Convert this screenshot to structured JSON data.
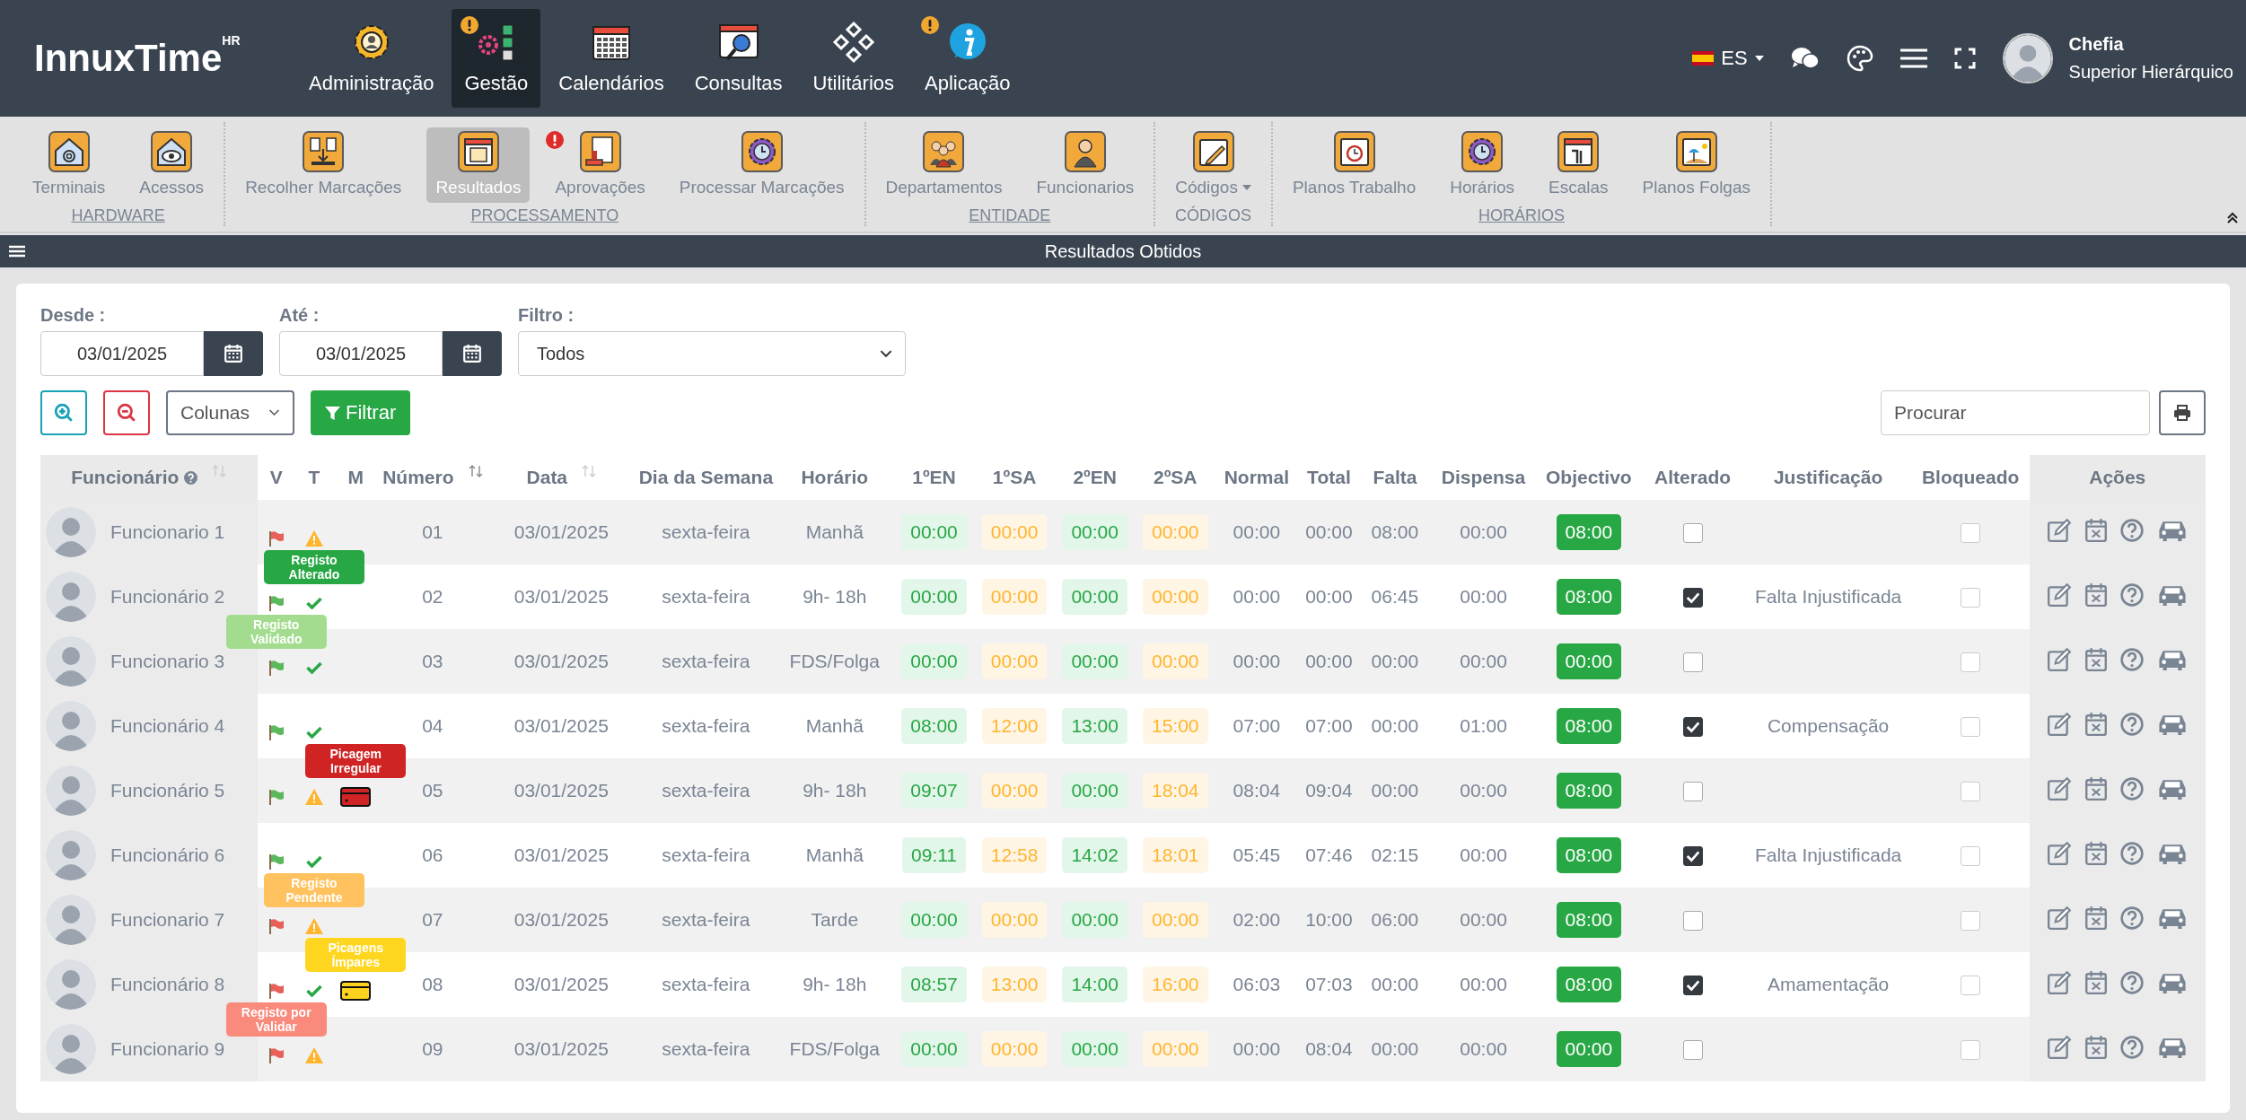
{
  "header": {
    "logo": "InnuxTime",
    "logo_sup": "HR",
    "nav": [
      {
        "label": "Administração",
        "selected": false,
        "alert": false
      },
      {
        "label": "Gestão",
        "selected": true,
        "alert": true
      },
      {
        "label": "Calendários",
        "selected": false,
        "alert": false
      },
      {
        "label": "Consultas",
        "selected": false,
        "alert": false
      },
      {
        "label": "Utilitários",
        "selected": false,
        "alert": false
      },
      {
        "label": "Aplicação",
        "selected": false,
        "alert": true
      }
    ],
    "language": "ES",
    "user": {
      "name": "Chefia",
      "role": "Superior Hierárquico"
    }
  },
  "toolbar": {
    "groups": [
      {
        "label": "HARDWARE",
        "link": true,
        "items": [
          {
            "label": "Terminais",
            "selected": false,
            "alert": false,
            "dropdown": false
          },
          {
            "label": "Acessos",
            "selected": false,
            "alert": false,
            "dropdown": false
          }
        ]
      },
      {
        "label": "PROCESSAMENTO",
        "link": true,
        "items": [
          {
            "label": "Recolher Marcações",
            "selected": false,
            "alert": false,
            "dropdown": false
          },
          {
            "label": "Resultados",
            "selected": true,
            "alert": false,
            "dropdown": false
          },
          {
            "label": "Aprovações",
            "selected": false,
            "alert": true,
            "dropdown": false
          },
          {
            "label": "Processar Marcações",
            "selected": false,
            "alert": false,
            "dropdown": false
          }
        ]
      },
      {
        "label": "ENTIDADE",
        "link": true,
        "items": [
          {
            "label": "Departamentos",
            "selected": false,
            "alert": false,
            "dropdown": false
          },
          {
            "label": "Funcionarios",
            "selected": false,
            "alert": false,
            "dropdown": false
          }
        ]
      },
      {
        "label": "CÓDIGOS",
        "link": false,
        "items": [
          {
            "label": "Códigos",
            "selected": false,
            "alert": false,
            "dropdown": true
          }
        ]
      },
      {
        "label": "HORÁRIOS",
        "link": true,
        "items": [
          {
            "label": "Planos Trabalho",
            "selected": false,
            "alert": false,
            "dropdown": false
          },
          {
            "label": "Horários",
            "selected": false,
            "alert": false,
            "dropdown": false
          },
          {
            "label": "Escalas",
            "selected": false,
            "alert": false,
            "dropdown": false
          },
          {
            "label": "Planos Folgas",
            "selected": false,
            "alert": false,
            "dropdown": false
          }
        ]
      }
    ]
  },
  "panel_title": "Resultados Obtidos",
  "filters": {
    "from": {
      "label": "Desde :",
      "value": "03/01/2025"
    },
    "to": {
      "label": "Até :",
      "value": "03/01/2025"
    },
    "filter": {
      "label": "Filtro :",
      "value": "Todos"
    },
    "columns_select": "Colunas",
    "filter_button": "Filtrar",
    "search": {
      "placeholder": "Procurar"
    }
  },
  "table": {
    "columns": [
      "Funcionário",
      "V",
      "T",
      "M",
      "Número",
      "Data",
      "Dia da Semana",
      "Horário",
      "1ºEN",
      "1ºSA",
      "2ºEN",
      "2ºSA",
      "Normal",
      "Total",
      "Falta",
      "Dispensa",
      "Objectivo",
      "Alterado",
      "Justificação",
      "Bloqueado",
      "Ações"
    ],
    "rows": [
      {
        "employee": "Funcionario 1",
        "v": {
          "validated": false
        },
        "t": {
          "ok": false
        },
        "number": "01",
        "date": "03/01/2025",
        "weekday": "sexta-feira",
        "schedule": "Manhã",
        "in_1": "00:00",
        "out_1": "00:00",
        "in_2": "00:00",
        "out_2": "00:00",
        "normal": "00:00",
        "total": "00:00",
        "absence": "08:00",
        "exemption": "00:00",
        "objective": "08:00",
        "changed": false,
        "blocked": false
      },
      {
        "employee": "Funcionário 2",
        "v": {
          "validated": true
        },
        "t": {
          "ok": true,
          "tooltip": {
            "text": "Registo Alterado",
            "color": "#28a745"
          }
        },
        "number": "02",
        "date": "03/01/2025",
        "weekday": "sexta-feira",
        "schedule": "9h- 18h",
        "in_1": "00:00",
        "out_1": "00:00",
        "in_2": "00:00",
        "out_2": "00:00",
        "normal": "00:00",
        "total": "00:00",
        "absence": "06:45",
        "exemption": "00:00",
        "objective": "08:00",
        "changed": true,
        "justification": "Falta Injustificada",
        "blocked": false
      },
      {
        "employee": "Funcionario 3",
        "v": {
          "validated": true,
          "tooltip": {
            "text": "Registo Validado",
            "color": "#a3dc8f"
          }
        },
        "t": {
          "ok": true
        },
        "number": "03",
        "date": "03/01/2025",
        "weekday": "sexta-feira",
        "schedule": "FDS/Folga",
        "in_1": "00:00",
        "out_1": "00:00",
        "in_2": "00:00",
        "out_2": "00:00",
        "normal": "00:00",
        "total": "00:00",
        "absence": "00:00",
        "exemption": "00:00",
        "objective": "00:00",
        "changed": false,
        "blocked": false
      },
      {
        "employee": "Funcionário 4",
        "v": {
          "validated": true
        },
        "t": {
          "ok": true
        },
        "number": "04",
        "date": "03/01/2025",
        "weekday": "sexta-feira",
        "schedule": "Manhã",
        "in_1": "08:00",
        "out_1": "12:00",
        "in_2": "13:00",
        "out_2": "15:00",
        "normal": "07:00",
        "total": "07:00",
        "absence": "00:00",
        "exemption": "01:00",
        "objective": "08:00",
        "changed": true,
        "justification": "Compensação",
        "blocked": false
      },
      {
        "employee": "Funcionário 5",
        "v": {
          "validated": true
        },
        "t": {
          "ok": false
        },
        "m": {
          "card": {
            "color": "#d02424"
          },
          "tooltip": {
            "text": "Picagem Irregular",
            "color": "#d02424"
          }
        },
        "number": "05",
        "date": "03/01/2025",
        "weekday": "sexta-feira",
        "schedule": "9h- 18h",
        "in_1": "09:07",
        "out_1": "00:00",
        "in_2": "00:00",
        "out_2": "18:04",
        "normal": "08:04",
        "total": "09:04",
        "absence": "00:00",
        "exemption": "00:00",
        "objective": "08:00",
        "changed": false,
        "blocked": false
      },
      {
        "employee": "Funcionário 6",
        "v": {
          "validated": true
        },
        "t": {
          "ok": true
        },
        "number": "06",
        "date": "03/01/2025",
        "weekday": "sexta-feira",
        "schedule": "Manhã",
        "in_1": "09:11",
        "out_1": "12:58",
        "in_2": "14:02",
        "out_2": "18:01",
        "normal": "05:45",
        "total": "07:46",
        "absence": "02:15",
        "exemption": "00:00",
        "objective": "08:00",
        "changed": true,
        "justification": "Falta Injustificada",
        "blocked": false
      },
      {
        "employee": "Funcionario 7",
        "v": {
          "validated": false
        },
        "t": {
          "ok": false,
          "tooltip": {
            "text": "Registo Pendente",
            "color": "#ffc25e"
          }
        },
        "number": "07",
        "date": "03/01/2025",
        "weekday": "sexta-feira",
        "schedule": "Tarde",
        "in_1": "00:00",
        "out_1": "00:00",
        "in_2": "00:00",
        "out_2": "00:00",
        "normal": "02:00",
        "total": "10:00",
        "absence": "06:00",
        "exemption": "00:00",
        "objective": "08:00",
        "changed": false,
        "blocked": false
      },
      {
        "employee": "Funcionário 8",
        "v": {
          "validated": false
        },
        "t": {
          "ok": true
        },
        "m": {
          "card": {
            "color": "#ffd21f"
          },
          "tooltip": {
            "text": "Picagens Ímpares",
            "color": "#ffd61f"
          }
        },
        "number": "08",
        "date": "03/01/2025",
        "weekday": "sexta-feira",
        "schedule": "9h- 18h",
        "in_1": "08:57",
        "out_1": "13:00",
        "in_2": "14:00",
        "out_2": "16:00",
        "normal": "06:03",
        "total": "07:03",
        "absence": "00:00",
        "exemption": "00:00",
        "objective": "08:00",
        "changed": true,
        "justification": "Amamentação",
        "blocked": false
      },
      {
        "employee": "Funcionario 9",
        "v": {
          "validated": false,
          "tooltip": {
            "text": "Registo por Validar",
            "color": "#f98a7c"
          }
        },
        "t": {
          "ok": false
        },
        "number": "09",
        "date": "03/01/2025",
        "weekday": "sexta-feira",
        "schedule": "FDS/Folga",
        "in_1": "00:00",
        "out_1": "00:00",
        "in_2": "00:00",
        "out_2": "00:00",
        "normal": "00:00",
        "total": "08:04",
        "absence": "00:00",
        "exemption": "00:00",
        "objective": "00:00",
        "changed": false,
        "blocked": false
      }
    ]
  }
}
